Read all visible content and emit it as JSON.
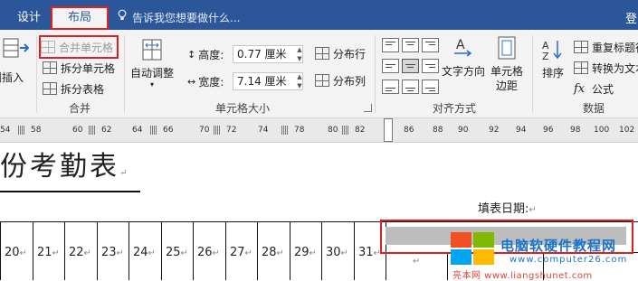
{
  "tabs": [
    {
      "label": "设计",
      "active": false
    },
    {
      "label": "布局",
      "active": true
    }
  ],
  "tell_me": "告诉我您想要做什么...",
  "login_partial": "登",
  "ribbon": {
    "insert_partial": "侧插入",
    "merge": {
      "merge_cells": "合并单元格",
      "split_cells": "拆分单元格",
      "split_table": "拆分表格",
      "label": "合并"
    },
    "cell_size": {
      "autofit": "自动调整",
      "height_label": "高度:",
      "height_value": "0.77 厘米",
      "width_label": "宽度:",
      "width_value": "7.14 厘米",
      "distribute_rows": "分布行",
      "distribute_cols": "分布列",
      "label": "单元格大小"
    },
    "alignment": {
      "text_direction": "文字方向",
      "cell_margins_l1": "单元格",
      "cell_margins_l2": "边距",
      "label": "对齐方式"
    },
    "data": {
      "sort": "排序",
      "repeat_header": "重复标题行",
      "convert": "转换为文本",
      "formula": "公式",
      "label": "数据"
    }
  },
  "ruler": {
    "numbers": [
      "54",
      "58",
      "60",
      "62",
      "64",
      "66",
      "70",
      "72",
      "74",
      "78",
      "80",
      "82",
      "86",
      "88",
      "90",
      "92",
      "94",
      "96",
      "98",
      "100",
      "102"
    ]
  },
  "document": {
    "title": "份考勤表",
    "fill_date": "填表日期:",
    "day_numbers": [
      "20",
      "21",
      "22",
      "23",
      "24",
      "25",
      "26",
      "27",
      "28",
      "29",
      "30",
      "31"
    ]
  },
  "watermark": {
    "site_name": "电脑软硬件教程网",
    "url": "www.computer26.com",
    "url_line2": "亮本网 www.liangshunet.com"
  },
  "colors": {
    "ribbon_blue": "#2b579a",
    "highlight_red": "#e02020",
    "watermark_blue": "#1a73c8"
  }
}
